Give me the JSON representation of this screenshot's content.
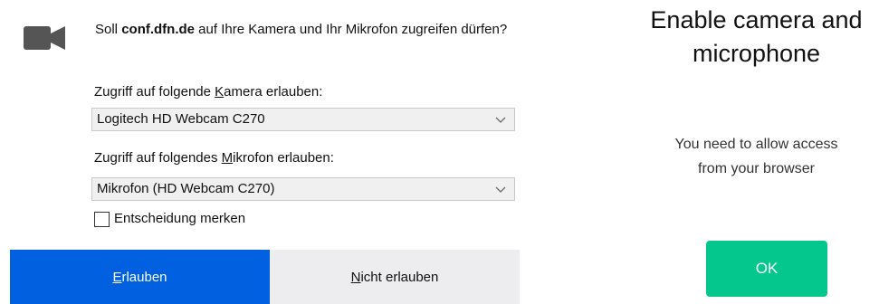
{
  "dialog": {
    "prompt_pre": "Soll ",
    "prompt_host": "conf.dfn.de",
    "prompt_post": " auf Ihre Kamera und Ihr Mikrofon zugreifen dürfen?",
    "camera_label_pre": "Zugriff auf folgende ",
    "camera_label_mnemonic": "K",
    "camera_label_post": "amera erlauben:",
    "camera_selected": "Logitech HD Webcam C270",
    "mic_label_pre": "Zugriff auf folgendes ",
    "mic_label_mnemonic": "M",
    "mic_label_post": "ikrofon erlauben:",
    "mic_selected": "Mikrofon (HD Webcam C270)",
    "remember_label": "Entscheidung merken",
    "remember_checked": false,
    "allow_mnemonic": "E",
    "allow_rest": "rlauben",
    "deny_mnemonic": "N",
    "deny_rest": "icht erlauben",
    "icon": "camera-icon",
    "colors": {
      "allow_button": "#0060df",
      "deny_button": "#ededf0"
    }
  },
  "info_card": {
    "title_line1": "Enable camera and",
    "title_line2": "microphone",
    "text_line1": "You need to allow access",
    "text_line2": "from your browser",
    "ok_label": "OK",
    "colors": {
      "ok_button": "#03c78c"
    }
  }
}
